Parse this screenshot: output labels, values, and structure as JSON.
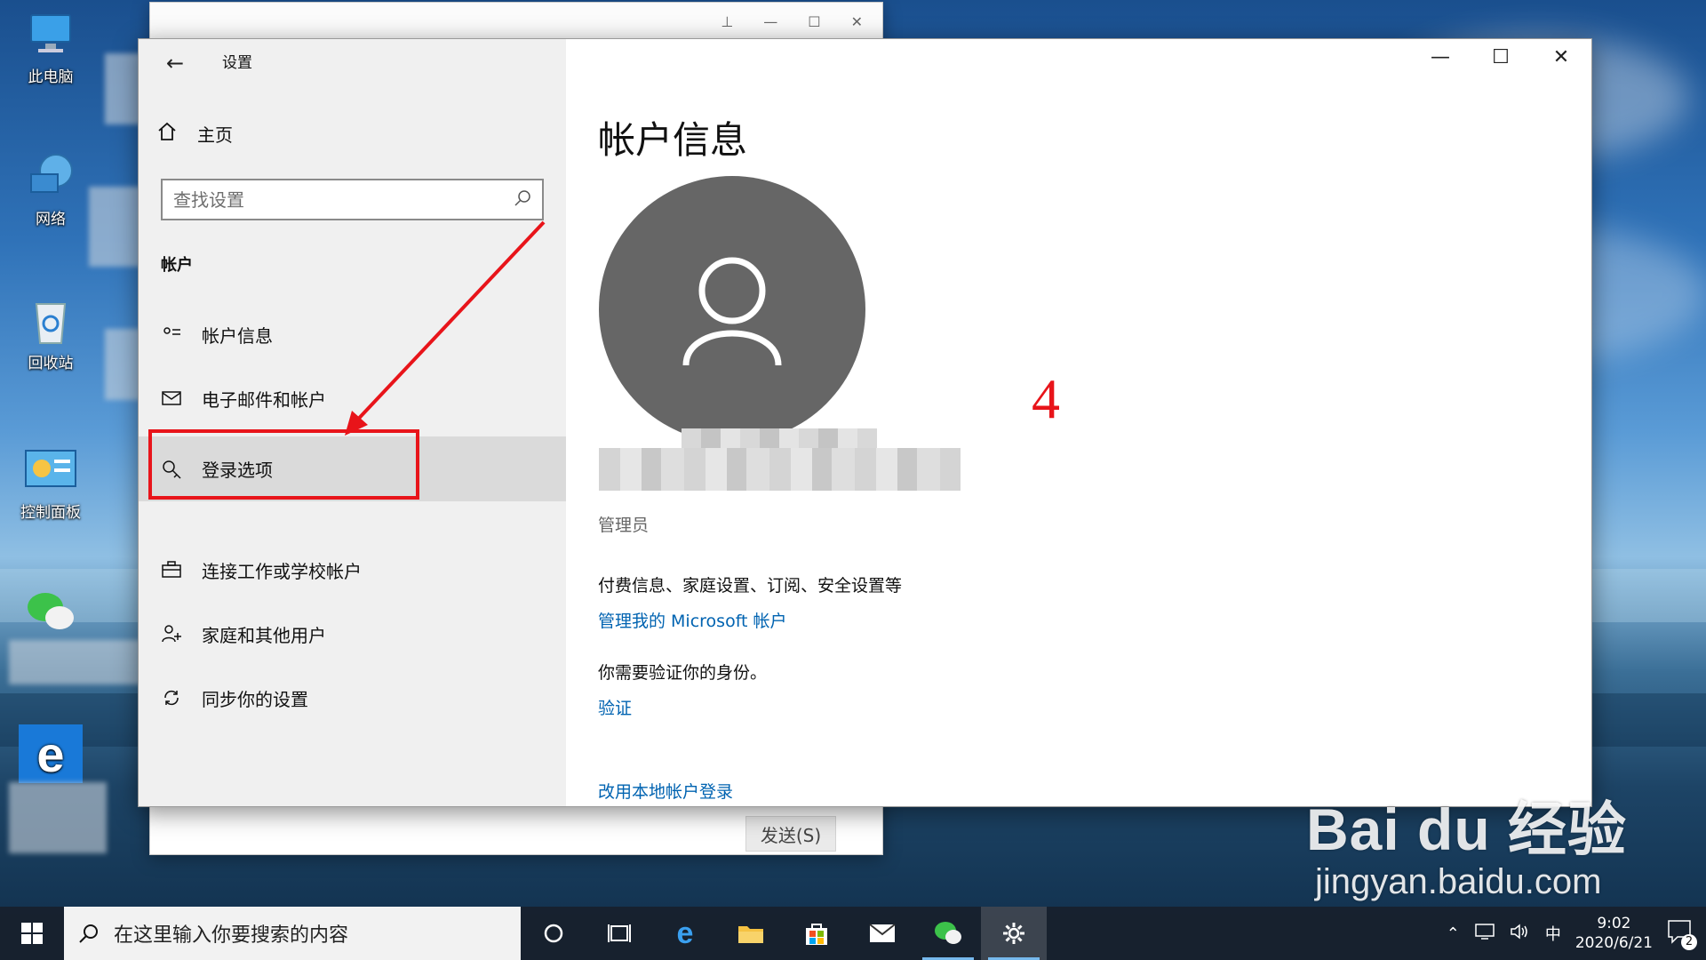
{
  "desktop": {
    "icons": [
      {
        "label": "此电脑"
      },
      {
        "label": "网络"
      },
      {
        "label": "回收站"
      },
      {
        "label": "控制面板"
      }
    ]
  },
  "background_window": {
    "send_button": "发送(S)"
  },
  "settings": {
    "app_title": "设置",
    "home_label": "主页",
    "search_placeholder": "查找设置",
    "section_heading": "帐户",
    "nav_items": [
      {
        "label": "帐户信息",
        "icon": "person-card-icon"
      },
      {
        "label": "电子邮件和帐户",
        "icon": "mail-icon"
      },
      {
        "label": "登录选项",
        "icon": "key-icon",
        "selected": true
      },
      {
        "label": "连接工作或学校帐户",
        "icon": "briefcase-icon"
      },
      {
        "label": "家庭和其他用户",
        "icon": "person-add-icon"
      },
      {
        "label": "同步你的设置",
        "icon": "sync-icon"
      }
    ],
    "main": {
      "title": "帐户信息",
      "role": "管理员",
      "billing_text": "付费信息、家庭设置、订阅、安全设置等",
      "manage_link": "管理我的 Microsoft 帐户",
      "verify_text": "你需要验证你的身份。",
      "verify_link": "验证",
      "local_link": "改用本地帐户登录"
    }
  },
  "annotation": {
    "step_number": "4",
    "color": "#e8141a"
  },
  "watermark": {
    "main": "Bai du 经验",
    "sub": "jingyan.baidu.com"
  },
  "taskbar": {
    "search_placeholder": "在这里输入你要搜索的内容",
    "ime": "中",
    "time": "9:02",
    "date": "2020/6/21",
    "notification_count": "2"
  }
}
